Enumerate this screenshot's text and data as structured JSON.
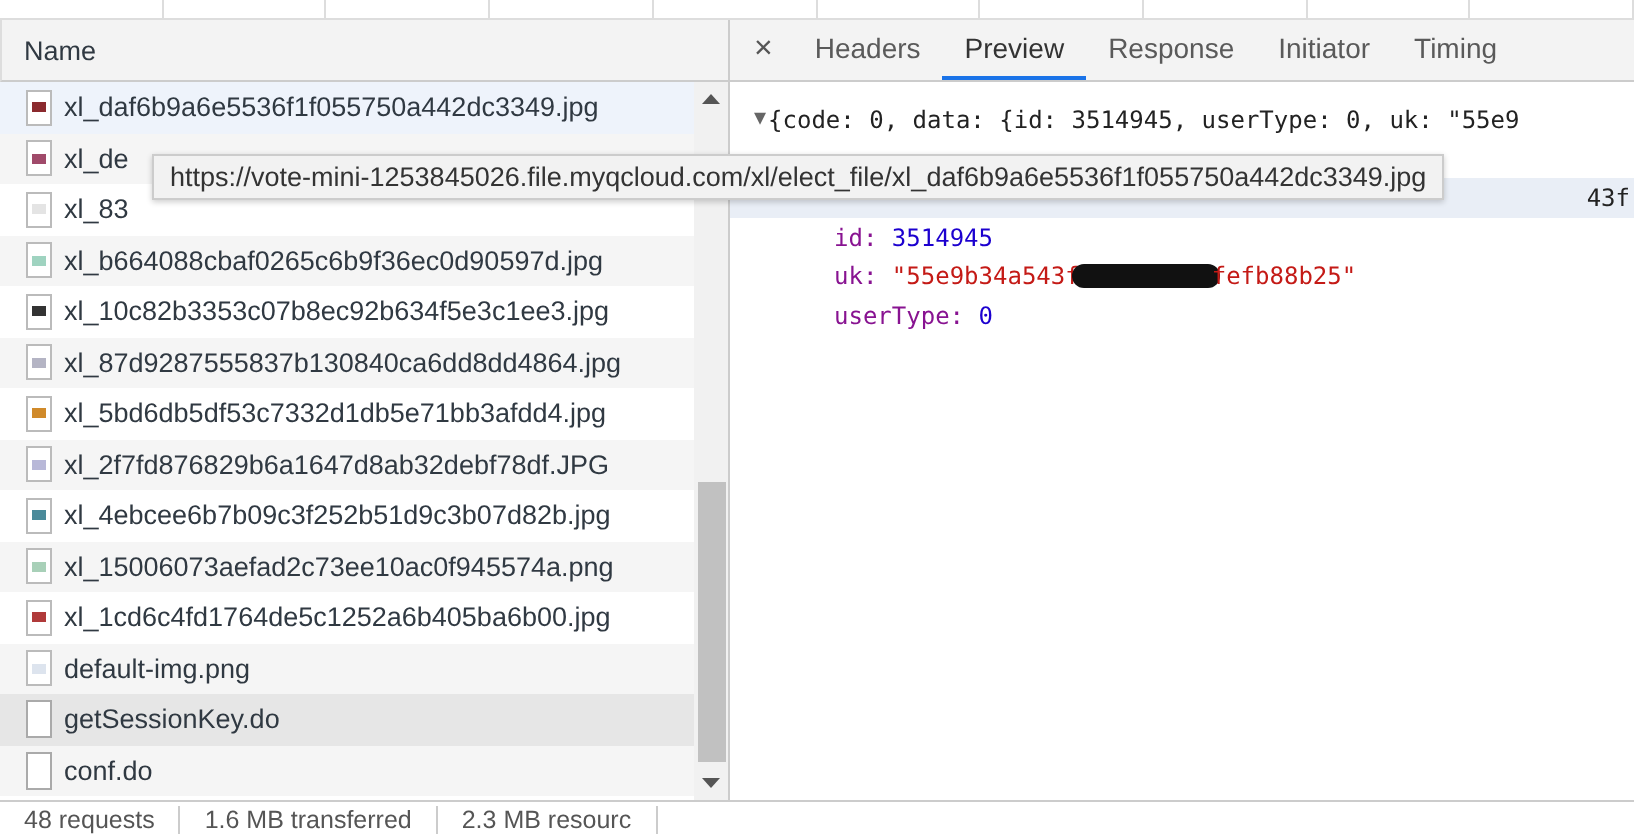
{
  "requests": {
    "column": "Name",
    "rows": [
      {
        "name": "xl_daf6b9a6e5536f1f055750a442dc3349.jpg",
        "kind": "image",
        "color": "#8b2a2e",
        "selected": true,
        "hovered": false
      },
      {
        "name": "xl_de",
        "kind": "image",
        "color": "#a04a6a",
        "selected": false,
        "hovered": false
      },
      {
        "name": "xl_83",
        "kind": "image",
        "color": "#e4e4e4",
        "selected": false,
        "hovered": false
      },
      {
        "name": "xl_b664088cbaf0265c6b9f36ec0d90597d.jpg",
        "kind": "image",
        "color": "#9fd3c0",
        "selected": false,
        "hovered": false
      },
      {
        "name": "xl_10c82b3353c07b8ec92b634f5e3c1ee3.jpg",
        "kind": "image",
        "color": "#333333",
        "selected": false,
        "hovered": false
      },
      {
        "name": "xl_87d9287555837b130840ca6dd8dd4864.jpg",
        "kind": "image",
        "color": "#b4b4c4",
        "selected": false,
        "hovered": false
      },
      {
        "name": "xl_5bd6db5df53c7332d1db5e71bb3afdd4.jpg",
        "kind": "image",
        "color": "#d08a2a",
        "selected": false,
        "hovered": false
      },
      {
        "name": "xl_2f7fd876829b6a1647d8ab32debf78df.JPG",
        "kind": "image",
        "color": "#b8b8d8",
        "selected": false,
        "hovered": false
      },
      {
        "name": "xl_4ebcee6b7b09c3f252b51d9c3b07d82b.jpg",
        "kind": "image",
        "color": "#4a8a9a",
        "selected": false,
        "hovered": false
      },
      {
        "name": "xl_15006073aefad2c73ee10ac0f945574a.png",
        "kind": "image",
        "color": "#a8d0b8",
        "selected": false,
        "hovered": false
      },
      {
        "name": "xl_1cd6c4fd1764de5c1252a6b405ba6b00.jpg",
        "kind": "image",
        "color": "#b03a3a",
        "selected": false,
        "hovered": false
      },
      {
        "name": "default-img.png",
        "kind": "image",
        "color": "#dde4ee",
        "selected": false,
        "hovered": false
      },
      {
        "name": "getSessionKey.do",
        "kind": "document",
        "selected": false,
        "hovered": true
      },
      {
        "name": "conf.do",
        "kind": "document",
        "selected": false,
        "hovered": false
      }
    ]
  },
  "tooltip": "https://vote-mini-1253845026.file.myqcloud.com/xl/elect_file/xl_daf6b9a6e5536f1f055750a442dc3349.jpg",
  "status_bar": [
    "48 requests",
    "1.6 MB transferred",
    "2.3 MB resourc"
  ],
  "detail": {
    "close": "×",
    "tabs": [
      {
        "label": "Headers",
        "selected": false
      },
      {
        "label": "Preview",
        "selected": true
      },
      {
        "label": "Response",
        "selected": false
      },
      {
        "label": "Initiator",
        "selected": false
      },
      {
        "label": "Timing",
        "selected": false
      }
    ],
    "lines": [
      {
        "kind": "summary",
        "toggle": "▼",
        "text": "{code: 0, data: {id: 3514945, userType: 0, uk: \"55e9"
      },
      {
        "kind": "spacer"
      },
      {
        "kind": "tail",
        "text": "43f"
      },
      {
        "kind": "number",
        "key": "id:",
        "value": "3514945"
      },
      {
        "kind": "string",
        "key": "uk:",
        "value_start": "\"55e9b34a543f",
        "value_end": "fefb88b25\"",
        "redacted": true
      },
      {
        "kind": "number",
        "key": "userType:",
        "value": "0"
      }
    ]
  }
}
